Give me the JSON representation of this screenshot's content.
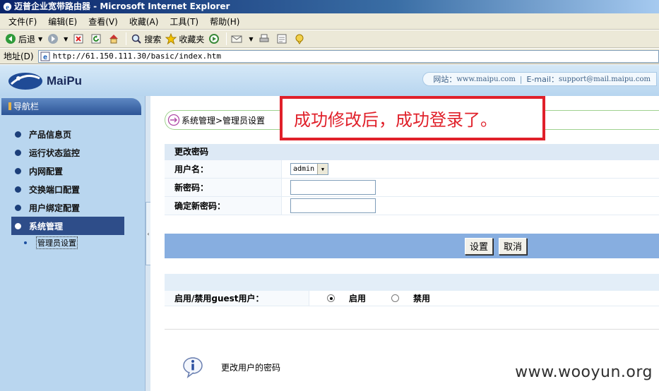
{
  "window": {
    "title": "迈普企业宽带路由器 - Microsoft Internet Explorer"
  },
  "menu": {
    "items": [
      "文件(F)",
      "编辑(E)",
      "查看(V)",
      "收藏(A)",
      "工具(T)",
      "帮助(H)"
    ]
  },
  "toolbar": {
    "back_label": "后退",
    "search_label": "搜索",
    "favorites_label": "收藏夹"
  },
  "address": {
    "label": "地址(D)",
    "url": "http://61.150.111.30/basic/index.htm"
  },
  "header": {
    "logo_text": "MaiPu",
    "site_label": "网站：",
    "site_url": "www.maipu.com",
    "email_label": "E-mail：",
    "email": "support@mail.maipu.com"
  },
  "sidebar": {
    "header": "导航栏",
    "items": [
      {
        "label": "产品信息页",
        "active": false
      },
      {
        "label": "运行状态监控",
        "active": false
      },
      {
        "label": "内网配置",
        "active": false
      },
      {
        "label": "交换端口配置",
        "active": false
      },
      {
        "label": "用户绑定配置",
        "active": false
      },
      {
        "label": "系统管理",
        "active": true
      }
    ],
    "sub_items": [
      {
        "label": "管理员设置"
      }
    ]
  },
  "content": {
    "breadcrumb": "系统管理>管理员设置",
    "annotation": "成功修改后，成功登录了。",
    "form": {
      "title": "更改密码",
      "username_label": "用户名：",
      "username_value": "admin",
      "new_password_label": "新密码：",
      "confirm_password_label": "确定新密码："
    },
    "buttons": {
      "set_label": "设置",
      "cancel_label": "取消"
    },
    "guest": {
      "label": "启用/禁用guest用户：",
      "enable_label": "启用",
      "disable_label": "禁用",
      "selected": "启用"
    },
    "help_text": "更改用户的密码"
  },
  "watermark": "www.wooyun.org",
  "colors": {
    "annotation_red": "#e0202a",
    "nav_active": "#2e4d89",
    "sidebar_bg": "#b9d6ef",
    "button_bar": "#87aee0"
  }
}
